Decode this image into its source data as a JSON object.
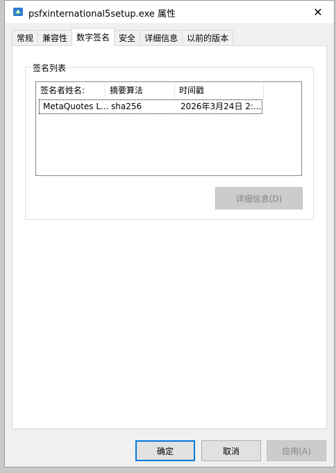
{
  "window": {
    "title": "psfxinternational5setup.exe 属性",
    "close_glyph": "✕"
  },
  "tabs": [
    {
      "label": "常规"
    },
    {
      "label": "兼容性"
    },
    {
      "label": "数字签名"
    },
    {
      "label": "安全"
    },
    {
      "label": "详细信息"
    },
    {
      "label": "以前的版本"
    }
  ],
  "signature_group": {
    "label": "签名列表",
    "columns": [
      "签名者姓名:",
      "摘要算法",
      "时间戳"
    ],
    "rows": [
      [
        "MetaQuotes L...",
        "sha256",
        "2026年3月24日 2:..."
      ]
    ],
    "details_button": "详细信息(D)"
  },
  "footer": {
    "ok": "确定",
    "cancel": "取消",
    "apply": "应用(A)"
  },
  "colors": {
    "accent": "#0078d7",
    "disabled_text": "#838383"
  }
}
